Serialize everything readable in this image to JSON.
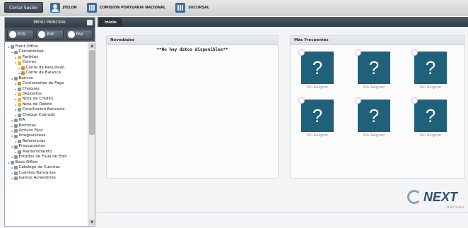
{
  "topbar": {
    "logout_label": "Cerrar Sesión",
    "user_label": "JTELON",
    "company_label": "COMISION PORTUARIA NACIONAL",
    "branch_label": "SUCURSAL"
  },
  "sidebar": {
    "title": "MENÚ PRINCIPAL",
    "tabs": [
      {
        "label": "POS",
        "icon": "pos-icon"
      },
      {
        "label": "ERP",
        "icon": "erp-icon"
      },
      {
        "label": "FAV",
        "icon": "star-icon"
      }
    ],
    "tree": [
      {
        "label": "Front Office",
        "level": 0,
        "icon": "pin"
      },
      {
        "label": "Contabilidad",
        "level": 1,
        "icon": "pin"
      },
      {
        "label": "Partidas",
        "level": 2,
        "icon": "folder"
      },
      {
        "label": "Cierres",
        "level": 2,
        "icon": "folder"
      },
      {
        "label": "Cierre de Resultado",
        "level": 3,
        "icon": "key"
      },
      {
        "label": "Cierre de Balance",
        "level": 3,
        "icon": "key"
      },
      {
        "label": "Bancos",
        "level": 1,
        "icon": "pin"
      },
      {
        "label": "Contraseñas de Pago",
        "level": 2,
        "icon": "key"
      },
      {
        "label": "Cheques",
        "level": 2,
        "icon": "doc"
      },
      {
        "label": "Depositos",
        "level": 2,
        "icon": "folder"
      },
      {
        "label": "Nota de Crédito",
        "level": 2,
        "icon": "folder"
      },
      {
        "label": "Nota de Débito",
        "level": 2,
        "icon": "folder"
      },
      {
        "label": "Conciliacion Bancaria",
        "level": 2,
        "icon": "doc"
      },
      {
        "label": "Cheque Cobrado",
        "level": 2,
        "icon": "doc"
      },
      {
        "label": "IVA",
        "level": 1,
        "icon": "pin"
      },
      {
        "label": "Nóminas",
        "level": 1,
        "icon": "pin"
      },
      {
        "label": "Activos Fijos",
        "level": 1,
        "icon": "pin"
      },
      {
        "label": "Integraciones",
        "level": 1,
        "icon": "pin"
      },
      {
        "label": "Referencias",
        "level": 2,
        "icon": "pin"
      },
      {
        "label": "Presupuestos",
        "level": 1,
        "icon": "pin"
      },
      {
        "label": "Mantenimiento",
        "level": 2,
        "icon": "pin"
      },
      {
        "label": "Estados de Flujo de Efec",
        "level": 1,
        "icon": "pin"
      },
      {
        "label": "Back Office",
        "level": 0,
        "icon": "pin"
      },
      {
        "label": "Catalogo de Cuentas",
        "level": 1,
        "icon": "doc"
      },
      {
        "label": "Cuentas Bancarias",
        "level": 1,
        "icon": "doc"
      },
      {
        "label": "Gastos Acreedores",
        "level": 1,
        "icon": "doc"
      }
    ]
  },
  "main": {
    "tab_label": "Inicio",
    "novedades": {
      "title": "Novedades",
      "empty_message": "**No hay datos disponibles**"
    },
    "frecuentes": {
      "title": "Más Frecuentes",
      "tiles": [
        {
          "label": "Sin Asignar",
          "glyph": "?"
        },
        {
          "label": "Sin Asignar",
          "glyph": "?"
        },
        {
          "label": "Sin Asignar",
          "glyph": "?"
        },
        {
          "label": "Sin Asignar",
          "glyph": "?"
        },
        {
          "label": "Sin Asignar",
          "glyph": "?"
        },
        {
          "label": "Sin Asignar",
          "glyph": "?"
        }
      ]
    },
    "logo": {
      "text": "NEXT",
      "sub": "SCAP Online"
    }
  },
  "colors": {
    "tile": "#1f607a",
    "header": "#3a4450",
    "background": "#f3f4f5"
  }
}
